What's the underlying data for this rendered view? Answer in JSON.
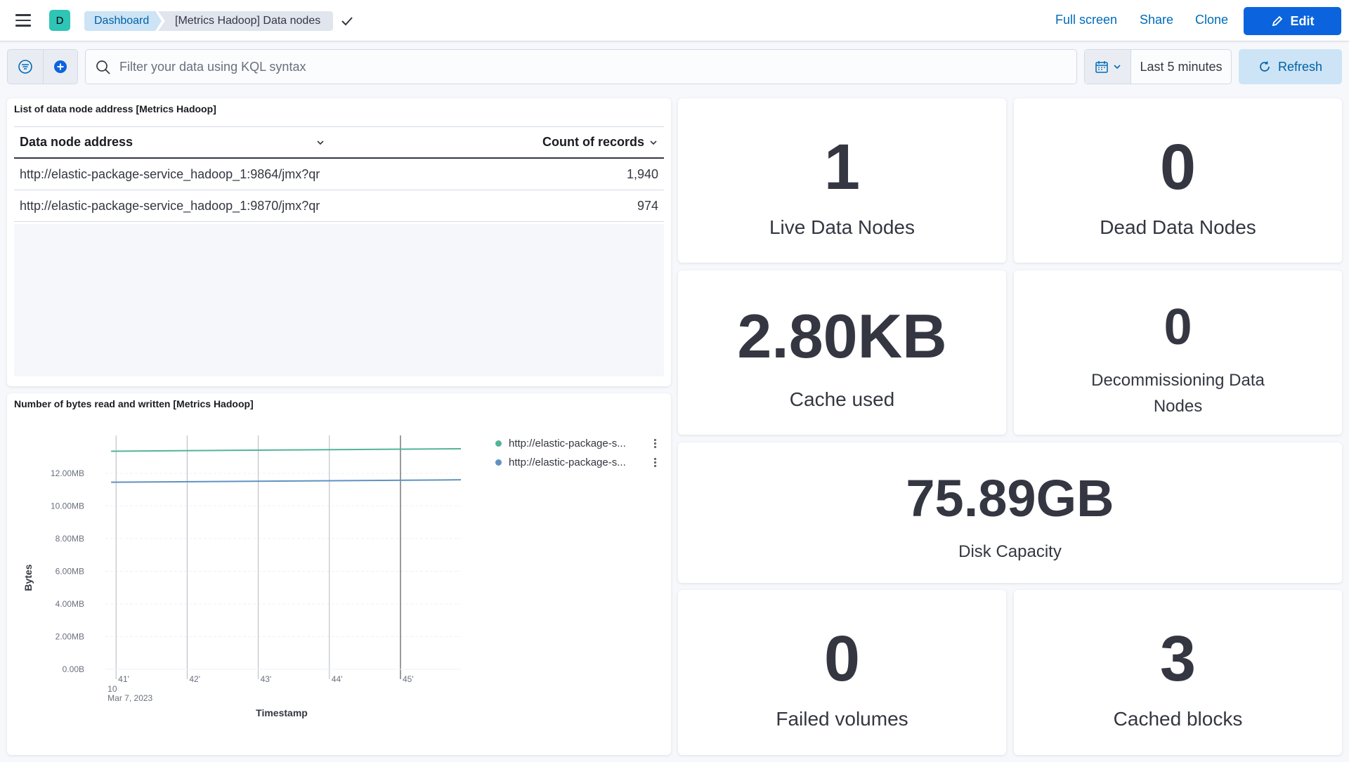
{
  "header": {
    "space_initial": "D",
    "breadcrumbs": [
      "Dashboard",
      "[Metrics Hadoop] Data nodes"
    ],
    "links": {
      "full_screen": "Full screen",
      "share": "Share",
      "clone": "Clone"
    },
    "edit_label": "Edit"
  },
  "query": {
    "placeholder": "Filter your data using KQL syntax",
    "time_range": "Last 5 minutes",
    "refresh_label": "Refresh"
  },
  "table_panel": {
    "title": "List of data node address [Metrics Hadoop]",
    "columns": [
      "Data node address",
      "Count of records"
    ],
    "rows": [
      {
        "address": "http://elastic-package-service_hadoop_1:9864/jmx?qr",
        "count": "1,940"
      },
      {
        "address": "http://elastic-package-service_hadoop_1:9870/jmx?qr",
        "count": "974"
      }
    ]
  },
  "metrics": {
    "live": {
      "value": "1",
      "label": "Live Data Nodes"
    },
    "dead": {
      "value": "0",
      "label": "Dead Data Nodes"
    },
    "cache": {
      "value": "2.80KB",
      "label": "Cache used"
    },
    "decom": {
      "value": "0",
      "label": "Decommissioning Data Nodes"
    },
    "disk": {
      "value": "75.89GB",
      "label": "Disk Capacity"
    },
    "failed": {
      "value": "0",
      "label": "Failed volumes"
    },
    "cached": {
      "value": "3",
      "label": "Cached blocks"
    }
  },
  "chart_panel": {
    "title": "Number of bytes read and written [Metrics Hadoop]",
    "legend": [
      "http://elastic-package-s...",
      "http://elastic-package-s..."
    ]
  },
  "chart_data": {
    "type": "line",
    "title": "Number of bytes read and written [Metrics Hadoop]",
    "xlabel": "Timestamp",
    "ylabel": "Bytes",
    "x_ticks": [
      "41'",
      "42'",
      "43'",
      "44'",
      "45'"
    ],
    "x_sub_label": [
      "10",
      "Mar 7, 2023"
    ],
    "y_ticks": [
      "0.00B",
      "2.00MB",
      "4.00MB",
      "6.00MB",
      "8.00MB",
      "10.00MB",
      "12.00MB"
    ],
    "ylim_mb": [
      0,
      13.8
    ],
    "grid": true,
    "legend_position": "right",
    "colors": [
      "#54b399",
      "#6092c0"
    ],
    "series": [
      {
        "name": "http://elastic-package-s...",
        "x_min": [
          40.93,
          45.85
        ],
        "values_mb": [
          13.35,
          13.5
        ]
      },
      {
        "name": "http://elastic-package-s...",
        "x_min": [
          40.93,
          45.85
        ],
        "values_mb": [
          11.45,
          11.6
        ]
      }
    ]
  }
}
